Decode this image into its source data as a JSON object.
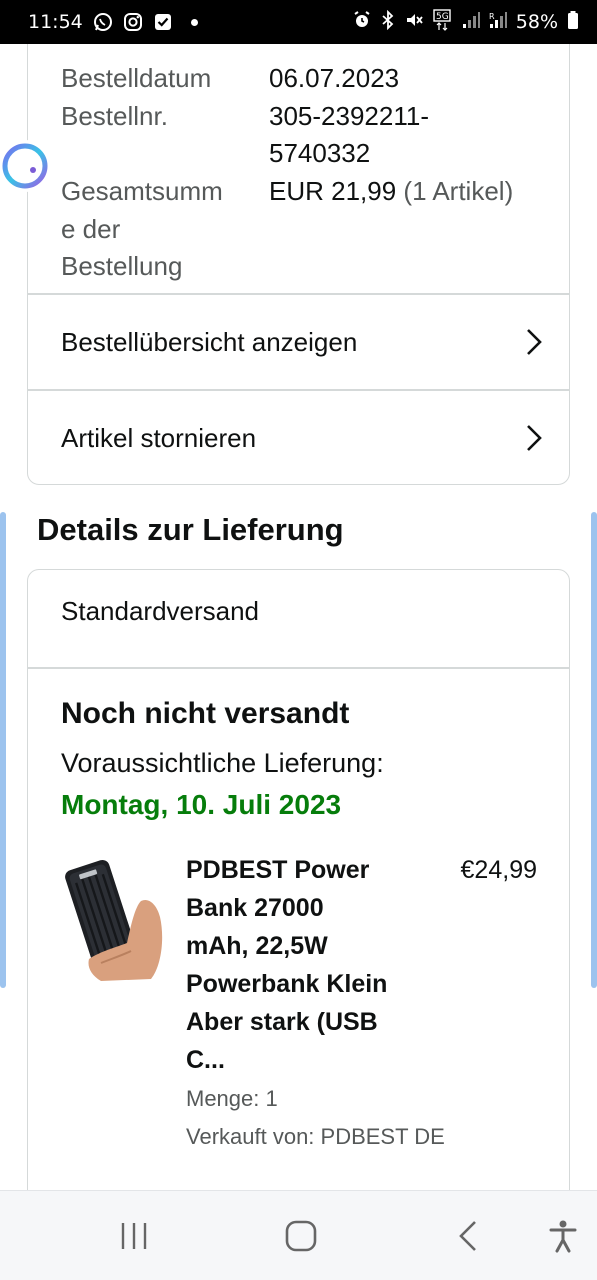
{
  "status_bar": {
    "time": "11:54",
    "battery": "58%",
    "left_icons": [
      "whatsapp-icon",
      "instagram-icon",
      "checkbox-icon"
    ],
    "right_icons": [
      "alarm-icon",
      "bluetooth-icon",
      "mute-icon",
      "network-5g-icon",
      "signal-icon",
      "signal-r-icon",
      "battery-icon"
    ]
  },
  "order": {
    "date_label": "Bestelldatum",
    "date_value": "06.07.2023",
    "number_label": "Bestellnr.",
    "number_value_line1": "305-2392211-",
    "number_value_line2": "5740332",
    "total_label_line1": "Gesamtsumm",
    "total_label_line2": "e der",
    "total_label_line3": "Bestellung",
    "total_value": "EUR 21,99",
    "total_count": "(1 Artikel)"
  },
  "actions": {
    "view_summary": "Bestellübersicht anzeigen",
    "cancel_items": "Artikel stornieren"
  },
  "delivery": {
    "section_title": "Details zur Lieferung",
    "method": "Standardversand",
    "status": "Noch nicht versandt",
    "expected_label": "Voraussichtliche Lieferung:",
    "expected_date": "Montag, 10. Juli 2023",
    "date_color": "#067d0b"
  },
  "product": {
    "title_line1": "PDBEST Power",
    "title_line2": "Bank 27000",
    "title_line3": "mAh, 22,5W",
    "title_line4": "Powerbank Klein",
    "title_line5": "Aber stark (USB",
    "title_line6": "C...",
    "price": "€24,99",
    "quantity": "Menge: 1",
    "seller": "Verkauft von: PDBEST DE"
  },
  "nav_bar": {
    "buttons": [
      "recent-apps-icon",
      "home-icon",
      "back-icon",
      "accessibility-icon"
    ]
  }
}
